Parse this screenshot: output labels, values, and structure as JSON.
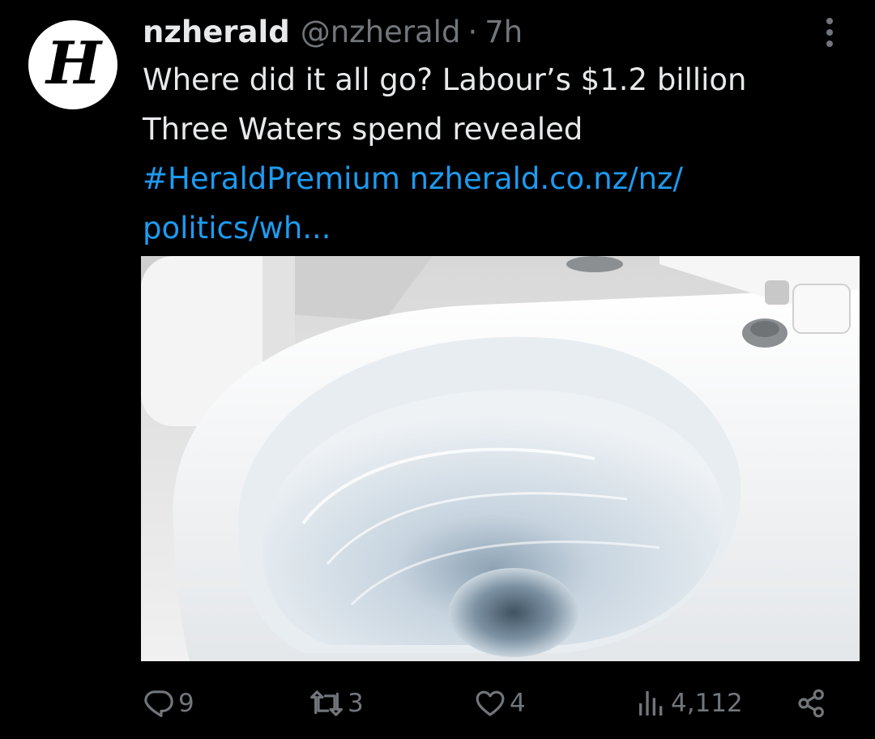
{
  "author": {
    "display_name": "nzherald",
    "handle": "@nzherald",
    "separator": "·",
    "time_ago": "7h",
    "avatar_glyph": "H",
    "avatar_icon": "nzherald-logo-icon"
  },
  "tweet": {
    "text_line1": "Where did it all go? Labour’s $1.2 billion",
    "text_line2": "Three Waters spend revealed",
    "hashtag": "#HeraldPremium",
    "link_part1": "nzherald.co.nz/nz/",
    "link_part2": "politics/wh..."
  },
  "media": {
    "icon": "toilet-bowl-photo"
  },
  "actions": {
    "reply": {
      "icon": "reply-icon",
      "count": "9"
    },
    "retweet": {
      "icon": "retweet-icon",
      "count": "3"
    },
    "like": {
      "icon": "heart-icon",
      "count": "4"
    },
    "views": {
      "icon": "views-icon",
      "count": "4,112"
    },
    "share": {
      "icon": "share-icon"
    }
  },
  "more_icon": "more-vertical-icon",
  "colors": {
    "background": "#000000",
    "text": "#e7e9ea",
    "secondary": "#71767b",
    "link": "#1d9bf0"
  }
}
